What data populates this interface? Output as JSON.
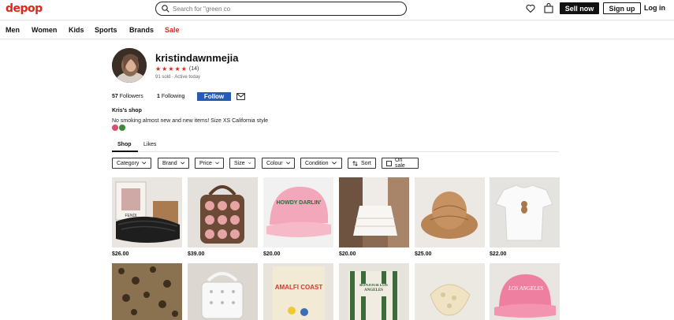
{
  "header": {
    "logo": "depop",
    "search_placeholder": "Search for \"green co",
    "sell_now": "Sell now",
    "sign_up": "Sign up",
    "log_in": "Log in"
  },
  "nav": [
    "Men",
    "Women",
    "Kids",
    "Sports",
    "Brands",
    "Sale"
  ],
  "profile": {
    "username": "kristindawnmejia",
    "rating_count": "(14)",
    "meta": "91 sold · Active today",
    "followers_count": "57",
    "followers_label": "Followers",
    "following_count": "1",
    "following_label": "Following",
    "follow_button": "Follow",
    "shop_name": "Kris's shop",
    "bio": "No smoking almost new and new items! Size XS California style"
  },
  "tabs": [
    "Shop",
    "Likes"
  ],
  "filters": [
    "Category",
    "Brand",
    "Price",
    "Size",
    "Colour",
    "Condition"
  ],
  "sort_label": "Sort",
  "on_sale_label": "On sale",
  "items": [
    {
      "price": "$26.00",
      "thumb_text": "FENDI"
    },
    {
      "price": "$39.00"
    },
    {
      "price": "$20.00",
      "thumb_text": "HOWDY DARLIN'"
    },
    {
      "price": "$20.00"
    },
    {
      "price": "$25.00"
    },
    {
      "price": "$22.00"
    }
  ],
  "items_row2": [
    {
      "thumb_text": ""
    },
    {
      "thumb_text": ""
    },
    {
      "thumb_text": "AMALFI COAST"
    },
    {
      "thumb_text": "BONJOUR LOS ANGELES"
    },
    {
      "thumb_text": ""
    },
    {
      "thumb_text": "LOS ANGELES"
    }
  ]
}
